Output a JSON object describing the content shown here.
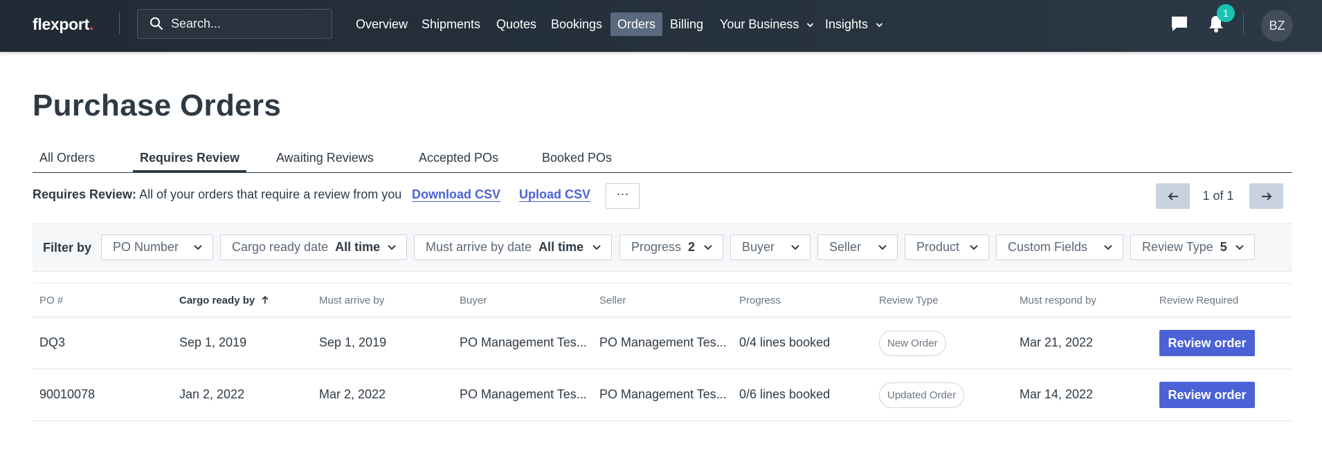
{
  "nav": {
    "logo_text": "flexport",
    "logo_dot": ".",
    "search_placeholder": "Search...",
    "links": [
      {
        "label": "Overview"
      },
      {
        "label": "Shipments"
      },
      {
        "label": "Quotes"
      },
      {
        "label": "Bookings"
      },
      {
        "label": "Orders",
        "active": true
      },
      {
        "label": "Billing"
      },
      {
        "label": "Your Business",
        "dropdown": true
      },
      {
        "label": "Insights",
        "dropdown": true
      }
    ],
    "notification_count": "1",
    "avatar_initials": "BZ"
  },
  "page": {
    "title": "Purchase Orders",
    "tabs": [
      {
        "label": "All Orders"
      },
      {
        "label": "Requires Review",
        "active": true
      },
      {
        "label": "Awaiting Reviews"
      },
      {
        "label": "Accepted POs"
      },
      {
        "label": "Booked POs"
      }
    ],
    "summary_label": "Requires Review:",
    "summary_text": "All of your orders that require a review from you",
    "download_csv": "Download CSV",
    "upload_csv": "Upload CSV",
    "more_label": "···",
    "pagination": "1 of 1"
  },
  "filters": {
    "label": "Filter by",
    "items": [
      {
        "label": "PO Number",
        "value": ""
      },
      {
        "label": "Cargo ready date",
        "value": "All time"
      },
      {
        "label": "Must arrive by date",
        "value": "All time"
      },
      {
        "label": "Progress",
        "value": "2"
      },
      {
        "label": "Buyer",
        "value": ""
      },
      {
        "label": "Seller",
        "value": ""
      },
      {
        "label": "Product",
        "value": ""
      },
      {
        "label": "Custom Fields",
        "value": ""
      },
      {
        "label": "Review Type",
        "value": "5"
      }
    ]
  },
  "table": {
    "columns": [
      "PO #",
      "Cargo ready by",
      "Must arrive by",
      "Buyer",
      "Seller",
      "Progress",
      "Review Type",
      "Must respond by",
      "Review Required"
    ],
    "sorted_column": "Cargo ready by",
    "rows": [
      {
        "po": "DQ3",
        "cargo_ready": "Sep 1, 2019",
        "must_arrive": "Sep 1, 2019",
        "buyer": "PO Management Tes...",
        "seller": "PO Management Tes...",
        "progress": "0/4 lines booked",
        "review_type": "New Order",
        "must_respond": "Mar 21, 2022",
        "action": "Review order"
      },
      {
        "po": "90010078",
        "cargo_ready": "Jan 2, 2022",
        "must_arrive": "Mar 2, 2022",
        "buyer": "PO Management Tes...",
        "seller": "PO Management Tes...",
        "progress": "0/6 lines booked",
        "review_type": "Updated Order",
        "must_respond": "Mar 14, 2022",
        "action": "Review order"
      }
    ]
  },
  "colors": {
    "nav_bg": "#222c36",
    "accent_blue": "#4b62d6",
    "badge_teal": "#19c3b3",
    "active_nav": "#5a6a7c"
  }
}
